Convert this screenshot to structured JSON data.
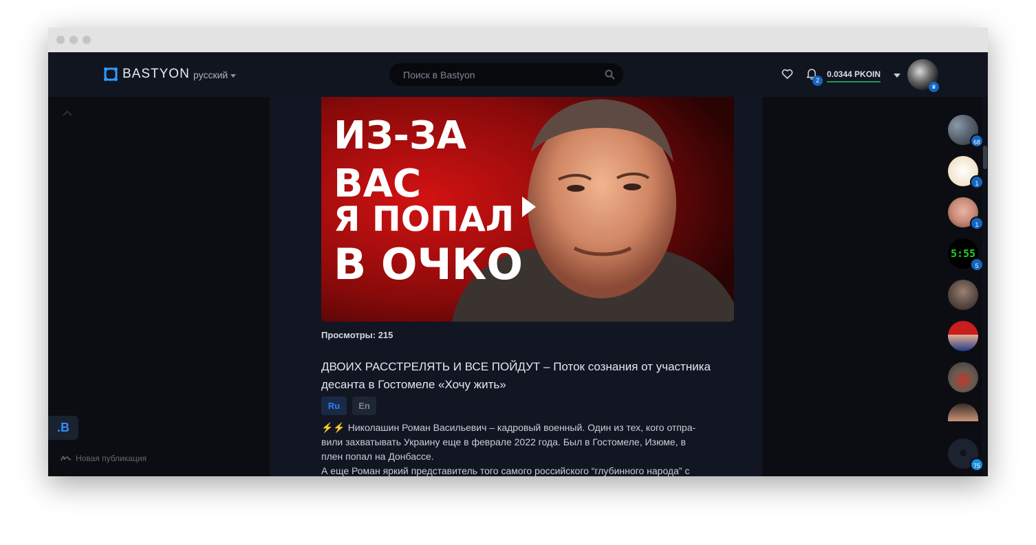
{
  "header": {
    "logo_text": "BASTYON",
    "language": "русский",
    "search_placeholder": "Поиск в Bastyon",
    "notifications_count": "2",
    "balance": "0.0344 PKOIN"
  },
  "left": {
    "brand_button": ".B",
    "new_post_label": "Новая публикация"
  },
  "post": {
    "thumbnail_lines": [
      "ИЗ-ЗА",
      "ВАС",
      "Я ПОПАЛ",
      "В ОЧКО"
    ],
    "views_label": "Просмотры: 215",
    "title": "ДВОИХ РАССТРЕЛЯТЬ И ВСЕ ПОЙДУТ – Поток сознания от участника десанта в Гостомеле «Хочу жить»",
    "lang_tabs": [
      "Ru",
      "En"
    ],
    "body_lines": [
      "⚡⚡ Николашин Роман Васильевич – кадровый военный. Один из тех, кого отпра-",
      "вили захватывать Украину еще в феврале 2022 года. Был в Гостомеле, Изюме, в",
      "плен попал на Донбассе.",
      "А еще Роман яркий представитель того самого российского “глубинного народа” с"
    ]
  },
  "contacts": [
    {
      "badge": "68"
    },
    {
      "badge": "1"
    },
    {
      "badge": "1"
    },
    {
      "badge": "5",
      "clock": "5:55"
    },
    {
      "badge": ""
    },
    {
      "badge": ""
    },
    {
      "badge": ""
    },
    {
      "badge": ""
    },
    {
      "badge": "75"
    }
  ],
  "colors": {
    "accent": "#1565c0",
    "background": "#0c0f15",
    "content_bg": "#121622",
    "balance_underline": "#1d9b57"
  }
}
